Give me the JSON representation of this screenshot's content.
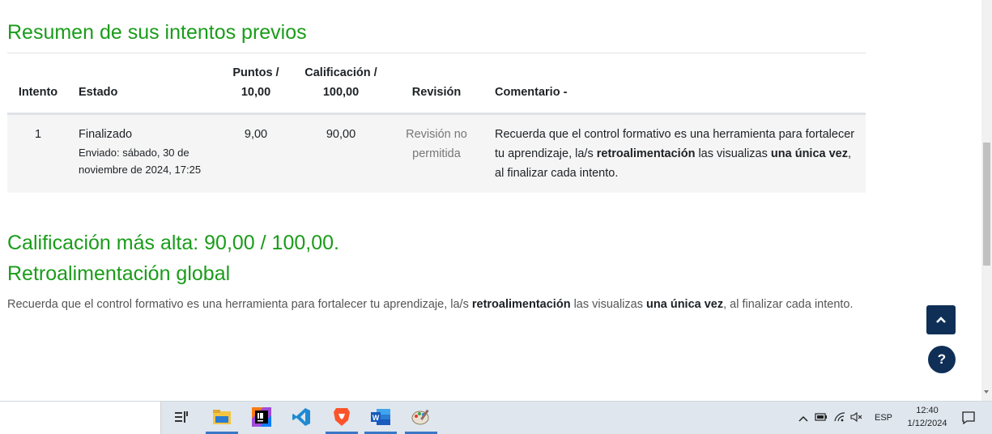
{
  "summary": {
    "heading": "Resumen de sus intentos previos",
    "columns": {
      "intento": "Intento",
      "estado": "Estado",
      "puntos_l1": "Puntos /",
      "puntos_l2": "10,00",
      "calif_l1": "Calificación /",
      "calif_l2": "100,00",
      "revision": "Revisión",
      "comentario": "Comentario -"
    },
    "rows": [
      {
        "intento": "1",
        "estado": "Finalizado",
        "enviado": "Enviado: sábado, 30 de noviembre de 2024, 17:25",
        "puntos": "9,00",
        "calificacion": "90,00",
        "revision": "Revisión no permitida",
        "comentario_a": "Recuerda que el control formativo es una herramienta para fortalecer tu aprendizaje, la/s ",
        "comentario_b": "retroalimentación",
        "comentario_c": " las visualizas ",
        "comentario_d": "una única vez",
        "comentario_e": ", al finalizar cada intento."
      }
    ]
  },
  "best_grade": "Calificación más alta: 90,00 / 100,00.",
  "feedback": {
    "heading": "Retroalimentación global",
    "text_a": "Recuerda que el control formativo es una herramienta para fortalecer tu aprendizaje, la/s ",
    "text_b": "retroalimentación",
    "text_c": " las visualizas ",
    "text_d": "una única vez",
    "text_e": ", al finalizar cada intento."
  },
  "floating": {
    "help_label": "?"
  },
  "taskbar": {
    "apps": [
      "task-view-icon",
      "file-explorer-icon",
      "intellij-icon",
      "vscode-icon",
      "brave-icon",
      "word-icon",
      "paint-icon"
    ],
    "language": "ESP",
    "time": "12:40",
    "date": "1/12/2024"
  },
  "colors": {
    "heading_green": "#1a9c1a",
    "button_navy": "#0f2f57",
    "row_bg": "#f5f5f5"
  }
}
